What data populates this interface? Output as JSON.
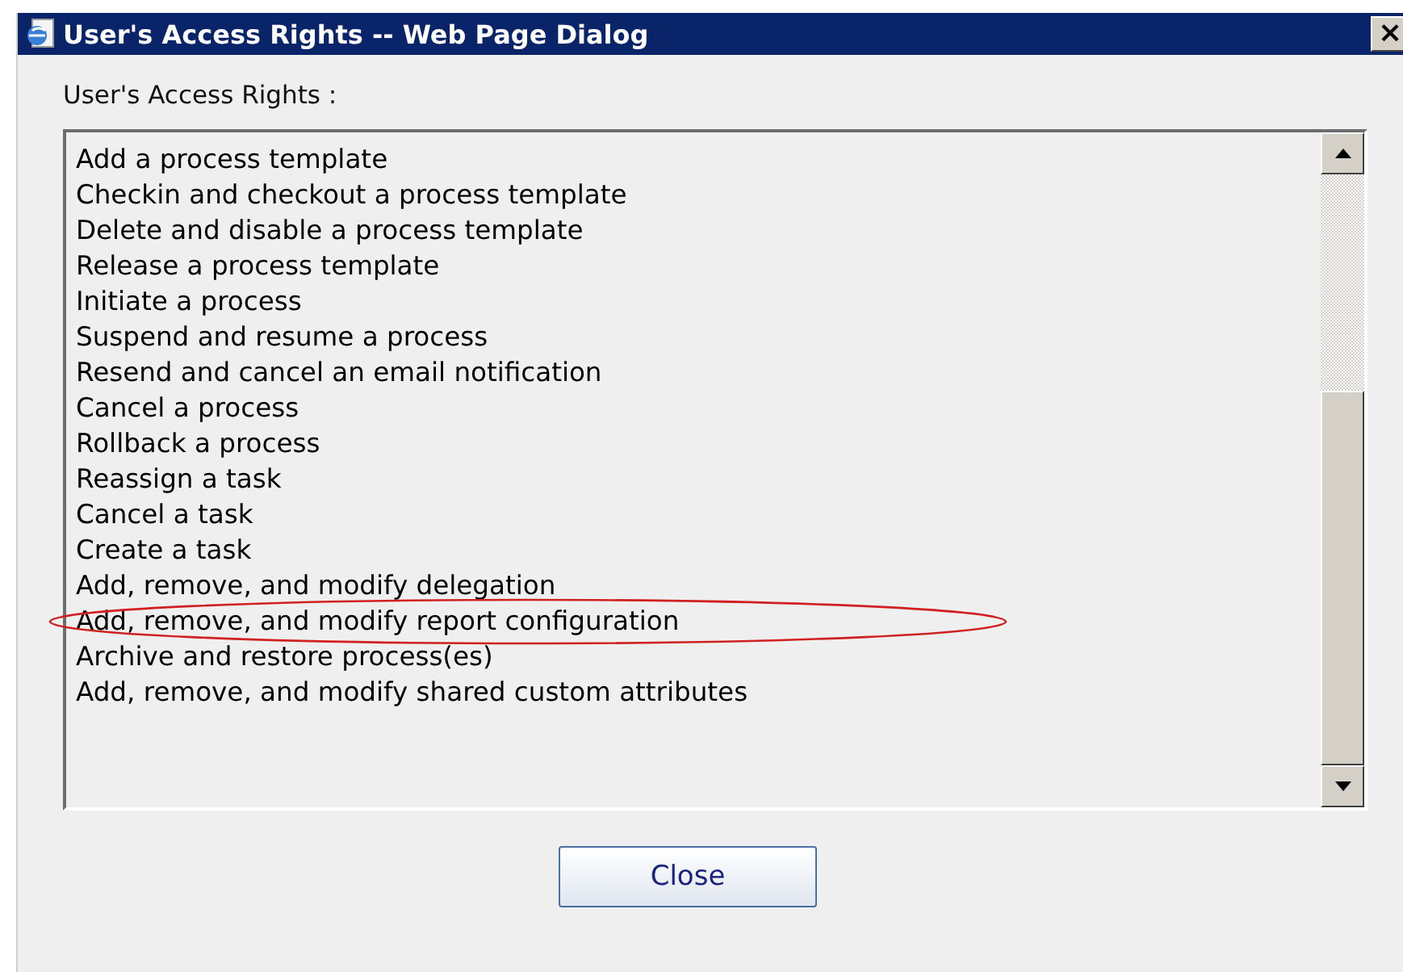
{
  "window": {
    "title": "User's Access Rights -- Web Page Dialog",
    "close_label": "×"
  },
  "list_label": "User's Access Rights :",
  "rights": [
    {
      "label": "Add a process template",
      "circled": false
    },
    {
      "label": "Checkin and checkout a process template",
      "circled": false
    },
    {
      "label": "Delete and disable a process template",
      "circled": false
    },
    {
      "label": "Release a process template",
      "circled": false
    },
    {
      "label": "Initiate a process",
      "circled": false
    },
    {
      "label": "Suspend and resume a process",
      "circled": false
    },
    {
      "label": "Resend and cancel an email notification",
      "circled": false
    },
    {
      "label": "Cancel a process",
      "circled": false
    },
    {
      "label": "Rollback a process",
      "circled": false
    },
    {
      "label": "Reassign a task",
      "circled": false
    },
    {
      "label": "Cancel a task",
      "circled": false
    },
    {
      "label": "Create a task",
      "circled": false
    },
    {
      "label": "Add, remove, and modify delegation",
      "circled": false
    },
    {
      "label": "Add, remove, and modify report configuration",
      "circled": true
    },
    {
      "label": "Archive and restore process(es)",
      "circled": false
    },
    {
      "label": "Add, remove, and modify shared custom attributes",
      "circled": false
    }
  ],
  "buttons": [
    "Close"
  ]
}
